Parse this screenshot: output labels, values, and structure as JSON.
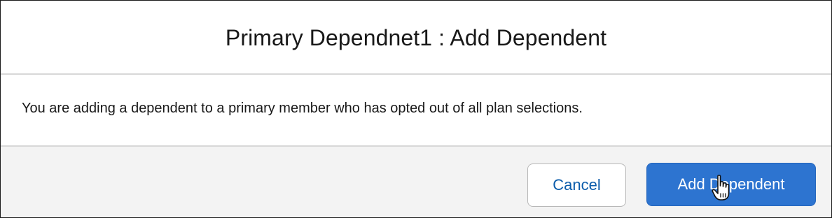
{
  "dialog": {
    "title": "Primary Dependnet1 : Add Dependent",
    "message": "You are adding a dependent to a primary member who has opted out of all plan selections."
  },
  "footer": {
    "cancel_label": "Cancel",
    "add_label": "Add Dependent"
  },
  "colors": {
    "primary_button": "#2d74d0",
    "cancel_text": "#0b5cab",
    "footer_background": "#f3f3f3"
  },
  "icons": {
    "cursor": "hand-pointer-icon"
  }
}
